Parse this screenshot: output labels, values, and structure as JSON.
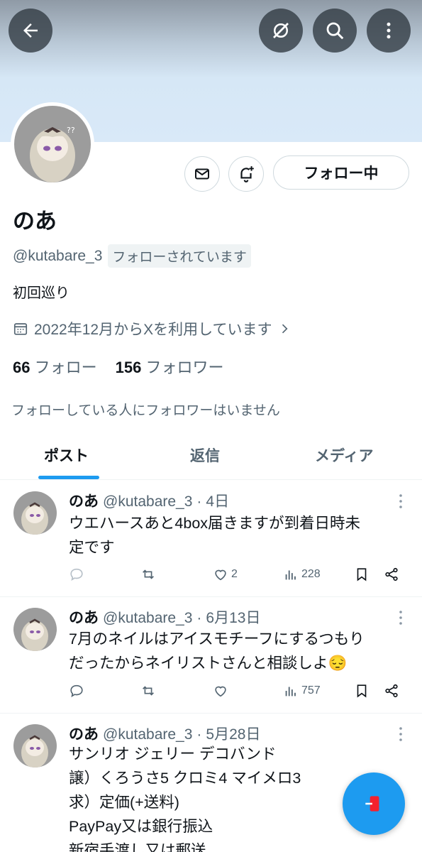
{
  "header": {
    "back_icon": "arrow-left-icon",
    "grok_icon": "grok-icon",
    "search_icon": "search-icon",
    "more_icon": "more-vertical-icon"
  },
  "profile": {
    "name": "のあ",
    "handle": "@kutabare_3",
    "follows_you": "フォローされています",
    "bio": "初回巡り",
    "joined": "2022年12月からXを利用しています",
    "following_count": "66",
    "following_label": "フォロー",
    "followers_count": "156",
    "followers_label": "フォロワー",
    "mutual_text": "フォローしている人にフォロワーはいません",
    "follow_button": "フォロー中"
  },
  "tabs": [
    {
      "label": "ポスト",
      "active": true
    },
    {
      "label": "返信",
      "active": false
    },
    {
      "label": "メディア",
      "active": false
    }
  ],
  "posts": [
    {
      "name": "のあ",
      "handle": "@kutabare_3",
      "time": "4日",
      "text_lines": [
        "ウエハースあと4box届きますが到着日時未",
        "定です"
      ],
      "likes": "2",
      "views": "228"
    },
    {
      "name": "のあ",
      "handle": "@kutabare_3",
      "time": "6月13日",
      "text_lines": [
        "7月のネイルはアイスモチーフにするつもり",
        "だったからネイリストさんと相談しよ😔"
      ],
      "likes": "",
      "views": "757"
    },
    {
      "name": "のあ",
      "handle": "@kutabare_3",
      "time": "5月28日",
      "text_lines": [
        "サンリオ ジェリー デコバンド",
        "譲）くろうさ5 クロミ4 マイメロ3",
        "求）定価(+送料)",
        "PayPay又は銀行振込",
        "新宿手渡し又は郵送"
      ]
    }
  ],
  "colors": {
    "accent": "#1d9bf0",
    "secondary_text": "#536471",
    "primary_text": "#0f1419"
  }
}
